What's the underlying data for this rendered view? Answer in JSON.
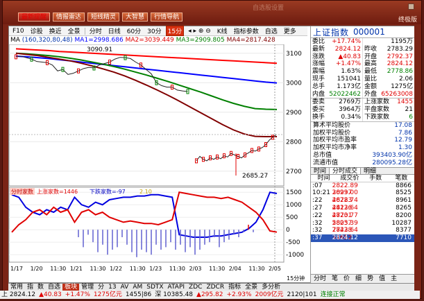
{
  "topbar": {
    "buttons": [
      "最新提醒",
      "情报雷达",
      "短线精灵",
      "大智慧",
      "行情导航"
    ],
    "right_tag": "终极版",
    "faint_center": "自选股设置"
  },
  "chart_toolbar": {
    "items": [
      "F10",
      "诊股",
      "换近",
      "全景",
      "分时",
      "日线",
      "60分",
      "30分",
      "15分",
      "K线",
      "指标参数",
      "自选",
      "更多"
    ],
    "active": "15分"
  },
  "ma_bar": {
    "prefix": "MA",
    "params": "(160,320,80,48)",
    "ma1": "MA1=2998.686",
    "ma2": "MA2=3039.449",
    "ma3": "MA3=2909.805",
    "ma4": "MA4=2817.428"
  },
  "price_axis": [
    "3100",
    "3000",
    "2900",
    "2800",
    "2700"
  ],
  "sub_axis": [
    "1500",
    "1000",
    "500",
    "0",
    "-500",
    "-1000"
  ],
  "annotations": {
    "high": "3090.91",
    "low": "2685.27"
  },
  "sub_legend": {
    "name": "分时家数",
    "up": "上涨家数=1446",
    "down": "下跌家数=-97",
    "ratio": "2.10"
  },
  "time_axis": [
    "1/17",
    "1/20",
    "11:30",
    "1/21",
    "11:30",
    "1/22",
    "11:30",
    "1/23",
    "11:30",
    "2/03",
    "11:30",
    "2/04",
    "11:30",
    "2/05"
  ],
  "time_tail": "15分钟",
  "panel": {
    "name": "上证指数",
    "code": "000001",
    "rows": [
      [
        [
          "委比",
          "+17.74%",
          "red"
        ],
        [
          "",
          "1195万",
          ""
        ]
      ],
      [
        [
          "最新",
          "2824.12",
          "red"
        ],
        [
          "昨收",
          "2783.29",
          ""
        ]
      ],
      [
        [
          "涨跌",
          "▲40.83",
          "red"
        ],
        [
          "开盘",
          "2792.37",
          "red"
        ]
      ],
      [
        [
          "涨幅",
          "+1.47%",
          "red"
        ],
        [
          "最高",
          "2824.12",
          "red"
        ]
      ],
      [
        [
          "震幅",
          "1.63%",
          ""
        ],
        [
          "最低",
          "2778.86",
          "green"
        ]
      ],
      [
        [
          "现手",
          "151041",
          ""
        ],
        [
          "量比",
          "2.06",
          ""
        ]
      ],
      [
        [
          "总手",
          "1.173亿",
          ""
        ],
        [
          "金额",
          "1275亿",
          ""
        ]
      ],
      [
        [
          "内盘",
          "52022462",
          "green"
        ],
        [
          "外盘",
          "65263008",
          "red"
        ]
      ]
    ],
    "rows2": [
      [
        [
          "委卖",
          "2769万",
          ""
        ],
        [
          "上涨家数",
          "1455",
          "red"
        ]
      ],
      [
        [
          "委买",
          "3964万",
          ""
        ],
        [
          "平盘家数",
          "21",
          ""
        ]
      ],
      [
        [
          "换手",
          "0.34%",
          ""
        ],
        [
          "下跌家数",
          "6",
          "green"
        ]
      ]
    ],
    "wide": [
      [
        "算术平均股价",
        "17.08"
      ],
      [
        "加权平均股价",
        "7.86"
      ],
      [
        "加权平均市盈率",
        "12.79"
      ],
      [
        "加权平均市净率",
        "1.30"
      ],
      [
        "总市值",
        "393403.90亿"
      ],
      [
        "流通市值",
        "280095.28亿"
      ]
    ],
    "tab_left": "时间",
    "tab_on": "分时成交",
    "tab_right": "明细",
    "thead": [
      "时间",
      "成交价",
      "手数",
      "笔数"
    ],
    "trades": [
      [
        ":07",
        "2822.89",
        "30997",
        "8866"
      ],
      [
        "10:21",
        "2823.00",
        "46783",
        "8525"
      ],
      [
        ":22",
        "2822.74",
        "44136",
        "8961"
      ],
      [
        ":27",
        "2822.64",
        "47701",
        "8265"
      ],
      [
        ":22",
        "2823.77",
        "58057",
        "8200"
      ],
      [
        ":32",
        "2823.39",
        "77428",
        "10287"
      ],
      [
        ":32",
        "2823.64",
        "31652",
        "8377"
      ],
      [
        ":37",
        "2824.12",
        "51041",
        "7710"
      ]
    ],
    "bottom_tabs": [
      "分时",
      "笔",
      "价",
      "细",
      "势",
      "值",
      "主"
    ]
  },
  "bottom_tabs": [
    "常用",
    "指",
    "数",
    "自选",
    "板块",
    "管理",
    "分",
    "13",
    "AV",
    "AM",
    "SDTX",
    "ATAPI",
    "ZDC",
    "ZDCR",
    "指标",
    "全景",
    "多分析"
  ],
  "ticker": {
    "label": "上 2824.12",
    "chg": "▲40.83",
    "pct": "+1.47%",
    "amt": "1275亿元",
    "b1": "1455|86",
    "s2": "深 10385.48",
    "chg2": "▲295.82",
    "pct2": "+2.93%",
    "amt2": "2009亿元",
    "b2": "2120|101",
    "tail": "连接正常"
  },
  "chart_data": {
    "type": "line",
    "title": "",
    "ylim": [
      2650,
      3130
    ],
    "price_series": {
      "name": "",
      "note": "intraday 15-min close",
      "values": [
        3088,
        3090,
        3085,
        3080,
        3072,
        3070,
        3068,
        3060,
        3040,
        3045,
        3028,
        3032,
        3040,
        3048,
        3052,
        3050,
        3060,
        3065,
        3070,
        3080,
        3086,
        3085,
        3082,
        3070,
        3060,
        3045,
        3030,
        3000,
        2990,
        2985,
        2985,
        2975,
        2972,
        2970
      ]
    },
    "series": [
      {
        "name": "MA1",
        "color": "#0000ff",
        "values": [
          3090,
          3088,
          3085,
          3082,
          3078,
          3074,
          3070,
          3066,
          3062,
          3058,
          3054,
          3050,
          3046,
          3042,
          3038,
          3034,
          3030,
          3026,
          3022,
          3018,
          3014,
          3010,
          3006,
          3002,
          2999
        ]
      },
      {
        "name": "MA2",
        "color": "#ff0000",
        "values": [
          3115,
          3113,
          3111,
          3109,
          3106,
          3104,
          3102,
          3100,
          3098,
          3096,
          3094,
          3092,
          3090,
          3088,
          3086,
          3084,
          3082,
          3080,
          3078,
          3076,
          3074,
          3072,
          3070,
          3068,
          3066
        ]
      },
      {
        "name": "MA3",
        "color": "#008000",
        "values": [
          3100,
          3098,
          3095,
          3092,
          3088,
          3083,
          3077,
          3070,
          3063,
          3055,
          3046,
          3036,
          3026,
          3015,
          3004,
          2992,
          2980,
          2968,
          2955,
          2942,
          2930,
          2920,
          2912,
          2910,
          2909
        ]
      },
      {
        "name": "MA4",
        "color": "#800000",
        "values": [
          3100,
          3096,
          3092,
          3086,
          3080,
          3074,
          3066,
          3057,
          3047,
          3036,
          3023,
          3008,
          2992,
          2975,
          2957,
          2938,
          2918,
          2898,
          2878,
          2858,
          2840,
          2826,
          2818,
          2817,
          2817
        ]
      }
    ],
    "tail_series": {
      "name": "",
      "values": [
        2735,
        2750,
        2740,
        2735,
        2745,
        2740,
        2748,
        2742,
        2752,
        2748,
        2760,
        2755,
        2750,
        2745,
        2755,
        2762,
        2770,
        2768,
        2775,
        2780,
        2790,
        2805,
        2815,
        2824
      ]
    },
    "breadth": {
      "up_values": [
        1400,
        1300,
        900,
        700,
        600,
        800,
        700,
        900,
        800,
        1300,
        1000,
        900,
        1100,
        1000,
        1200,
        1250,
        1300,
        1300,
        1350,
        1350,
        1400,
        1400,
        1350,
        1300,
        -200,
        -250,
        -300,
        -300,
        -300,
        -250,
        -250,
        -200,
        -150,
        -100,
        50,
        300,
        800,
        1500,
        1450
      ],
      "down_values": [
        -100,
        200,
        400,
        700,
        800,
        600,
        900,
        700,
        800,
        300,
        700,
        800,
        600,
        700,
        500,
        400,
        300,
        350,
        300,
        250,
        250,
        200,
        300,
        400,
        1500,
        1450,
        1400,
        1350,
        1300,
        1300,
        1250,
        1300,
        1200,
        1100,
        900,
        700,
        400,
        -50,
        -97
      ],
      "bars": [
        -300,
        -700,
        -200,
        -500,
        -900,
        -600,
        -1000,
        -800,
        -700,
        -300,
        -600,
        -900,
        -1100,
        -800,
        -900,
        -1000,
        -600,
        -800,
        -700,
        -500,
        -800,
        -600,
        -900,
        -700,
        -1000,
        -800,
        -600,
        -500,
        -300,
        -700,
        -500,
        -400,
        -200,
        -300,
        -100,
        200,
        -100
      ]
    }
  }
}
